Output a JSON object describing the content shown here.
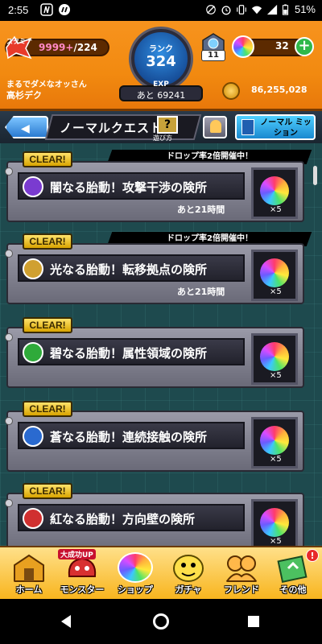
{
  "statusbar": {
    "time": "2:55",
    "battery": "51%"
  },
  "header": {
    "stamina_label": "スタミナ",
    "stamina_value": "9999+",
    "stamina_max": "/224",
    "rank_label": "ランク",
    "rank_value": "324",
    "exp_label": "EXP",
    "exp_remaining": "あと 69241",
    "player_name": "まるでダメなオッさん",
    "player_title": "高杉デク",
    "badge_count": "11",
    "orb_count": "32",
    "coins": "86,255,028"
  },
  "titlebar": {
    "title": "ノーマルクエスト",
    "help_label": "遊び方",
    "help_glyph": "?",
    "mission_label": "ノーマル ミッション"
  },
  "quests": [
    {
      "name": "闇なる胎動！攻撃干渉の険所",
      "clear": "CLEAR!",
      "drop_banner": "ドロップ率2倍開催中！",
      "remaining": "あと21時間",
      "reward": "×5",
      "icon_color": "#7a3bd0"
    },
    {
      "name": "光なる胎動！転移拠点の険所",
      "clear": "CLEAR!",
      "drop_banner": "ドロップ率2倍開催中！",
      "remaining": "あと21時間",
      "reward": "×5",
      "icon_color": "#d0a030"
    },
    {
      "name": "碧なる胎動！属性領域の険所",
      "clear": "CLEAR!",
      "drop_banner": "",
      "remaining": "",
      "reward": "×5",
      "icon_color": "#2faa3a"
    },
    {
      "name": "蒼なる胎動！連続接触の険所",
      "clear": "CLEAR!",
      "drop_banner": "",
      "remaining": "",
      "reward": "×5",
      "icon_color": "#2a6ad0"
    },
    {
      "name": "紅なる胎動！方向壁の険所",
      "clear": "CLEAR!",
      "drop_banner": "",
      "remaining": "",
      "reward": "×5",
      "icon_color": "#d03030"
    }
  ],
  "bottomnav": {
    "home": "ホーム",
    "monster": "モンスター",
    "monster_badge": "大成功UP",
    "shop": "ショップ",
    "gacha": "ガチャ",
    "friend": "フレンド",
    "other": "その他",
    "other_alert": "!"
  }
}
